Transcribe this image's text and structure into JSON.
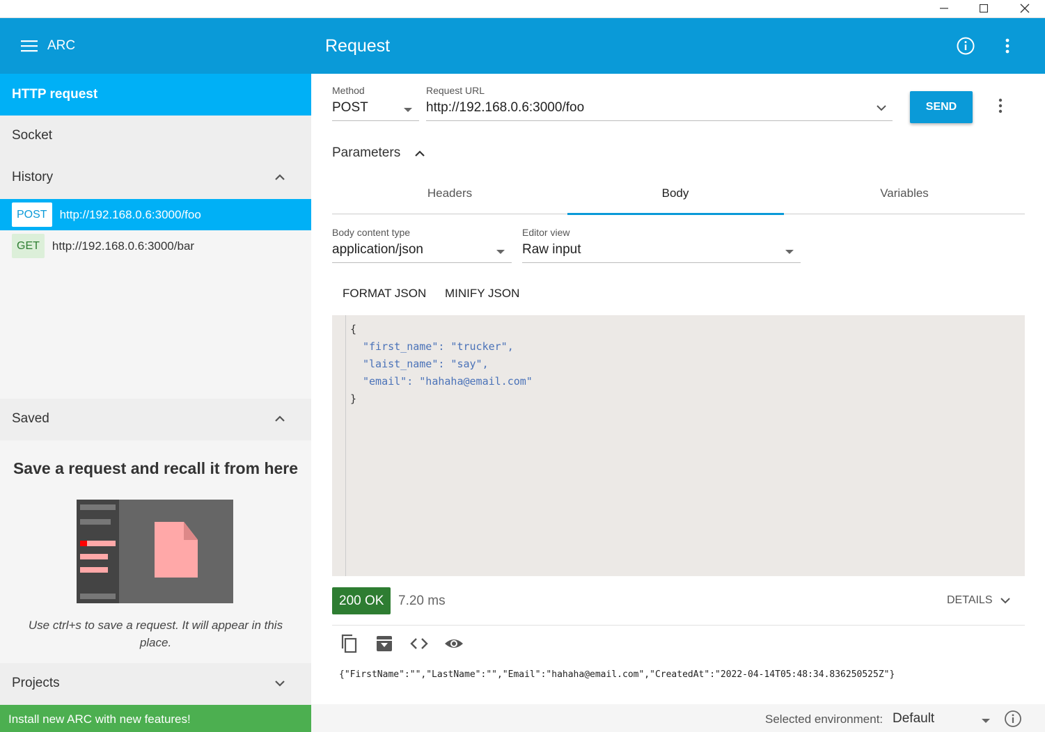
{
  "window": {
    "minimize": "─",
    "maximize": "☐",
    "close": "✕"
  },
  "app_name": "ARC",
  "page_title": "Request",
  "sidebar": {
    "nav_http": "HTTP request",
    "nav_socket": "Socket",
    "history_label": "History",
    "history": [
      {
        "method": "POST",
        "url": "http://192.168.0.6:3000/foo"
      },
      {
        "method": "GET",
        "url": "http://192.168.0.6:3000/bar"
      }
    ],
    "saved_label": "Saved",
    "saved_empty_title": "Save a request and recall it from here",
    "saved_hint": "Use ctrl+s to save a request. It will appear in this place.",
    "projects_label": "Projects",
    "install_banner": "Install new ARC with new features!"
  },
  "request": {
    "method_label": "Method",
    "method": "POST",
    "url_label": "Request URL",
    "url": "http://192.168.0.6:3000/foo",
    "send_label": "SEND",
    "parameters_label": "Parameters",
    "tabs": [
      "Headers",
      "Body",
      "Variables"
    ],
    "active_tab": "Body",
    "body_type_label": "Body content type",
    "body_type": "application/json",
    "editor_view_label": "Editor view",
    "editor_view": "Raw input",
    "format_json": "FORMAT JSON",
    "minify_json": "MINIFY JSON",
    "body_lines": [
      "{",
      "\"first_name\": \"trucker\",",
      "\"laist_name\": \"say\",",
      "\"email\": \"hahaha@email.com\"",
      "}"
    ]
  },
  "response": {
    "status": "200 OK",
    "time": "7.20 ms",
    "details_label": "DETAILS",
    "body": "{\"FirstName\":\"\",\"LastName\":\"\",\"Email\":\"hahaha@email.com\",\"CreatedAt\":\"2022-04-14T05:48:34.836250525Z\"}"
  },
  "footer": {
    "env_label": "Selected environment:",
    "env_value": "Default"
  },
  "colors": {
    "appbar": "#0a9ad8",
    "active_nav": "#00b0f6",
    "status_ok": "#2e7d32",
    "install": "#4caf50"
  },
  "icons": [
    "hamburger-icon",
    "info-icon",
    "more-vert-icon",
    "chevron-up-icon",
    "chevron-down-icon",
    "copy-icon",
    "save-icon",
    "code-icon",
    "eye-icon"
  ]
}
